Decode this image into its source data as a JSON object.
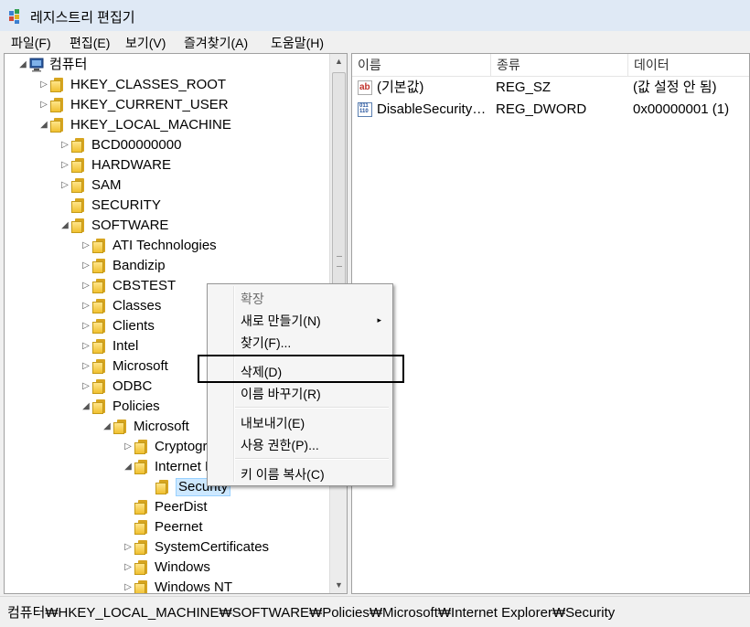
{
  "window": {
    "title": "레지스트리 편집기"
  },
  "menu": [
    "파일(F)",
    "편집(E)",
    "보기(V)",
    "즐겨찾기(A)",
    "도움말(H)"
  ],
  "tree": [
    {
      "label": "컴퓨터",
      "arrow": "◢",
      "kind": "computer"
    },
    {
      "label": "HKEY_CLASSES_ROOT",
      "arrow": "▷"
    },
    {
      "label": "HKEY_CURRENT_USER",
      "arrow": "▷"
    },
    {
      "label": "HKEY_LOCAL_MACHINE",
      "arrow": "◢"
    },
    {
      "label": "BCD00000000",
      "arrow": "▷"
    },
    {
      "label": "HARDWARE",
      "arrow": "▷"
    },
    {
      "label": "SAM",
      "arrow": "▷"
    },
    {
      "label": "SECURITY",
      "arrow": ""
    },
    {
      "label": "SOFTWARE",
      "arrow": "◢"
    },
    {
      "label": "ATI Technologies",
      "arrow": "▷"
    },
    {
      "label": "Bandizip",
      "arrow": "▷"
    },
    {
      "label": "CBSTEST",
      "arrow": "▷"
    },
    {
      "label": "Classes",
      "arrow": "▷"
    },
    {
      "label": "Clients",
      "arrow": "▷"
    },
    {
      "label": "Intel",
      "arrow": "▷"
    },
    {
      "label": "Microsoft",
      "arrow": "▷"
    },
    {
      "label": "ODBC",
      "arrow": "▷"
    },
    {
      "label": "Policies",
      "arrow": "◢"
    },
    {
      "label": "Microsoft",
      "arrow": "◢"
    },
    {
      "label": "Cryptography",
      "arrow": "▷"
    },
    {
      "label": "Internet Explorer",
      "arrow": "◢"
    },
    {
      "label": "Security",
      "arrow": "",
      "selected": true
    },
    {
      "label": "PeerDist",
      "arrow": ""
    },
    {
      "label": "Peernet",
      "arrow": ""
    },
    {
      "label": "SystemCertificates",
      "arrow": "▷"
    },
    {
      "label": "Windows",
      "arrow": "▷"
    },
    {
      "label": "Windows NT",
      "arrow": "▷"
    }
  ],
  "list": {
    "columns": [
      "이름",
      "종류",
      "데이터"
    ],
    "rows": [
      {
        "name": "(기본값)",
        "type": "REG_SZ",
        "data": "(값 설정 안 됨)",
        "icon": "string-value-icon",
        "icon_text": "ab"
      },
      {
        "name": "DisableSecuritySettingsCheck",
        "type": "REG_DWORD",
        "data": "0x00000001 (1)",
        "icon": "binary-value-icon",
        "icon_text": "011\n110"
      }
    ]
  },
  "context_menu": {
    "expand": "확장",
    "new": "새로 만들기(N)",
    "new_arrow": "▸",
    "find": "찾기(F)...",
    "delete": "삭제(D)",
    "rename": "이름 바꾸기(R)",
    "export": "내보내기(E)",
    "permissions": "사용 권한(P)...",
    "copy_key": "키 이름 복사(C)"
  },
  "scrollbar": {
    "up": "▲",
    "down": "▼"
  },
  "status": {
    "path": "컴퓨터₩HKEY_LOCAL_MACHINE₩SOFTWARE₩Policies₩Microsoft₩Internet Explorer₩Security"
  }
}
